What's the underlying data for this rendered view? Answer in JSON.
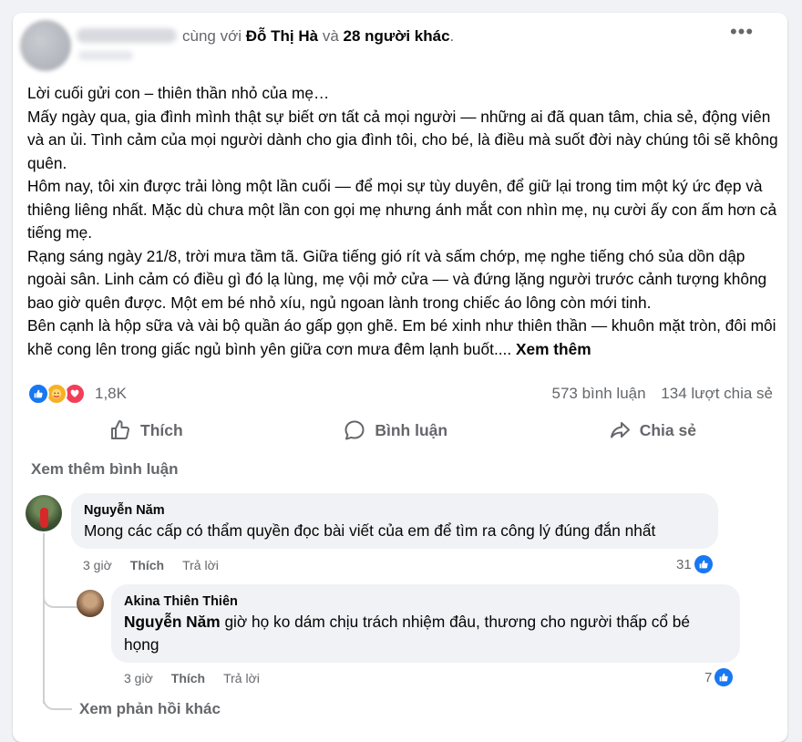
{
  "header": {
    "with_prefix": "cùng với",
    "tagged_person": "Đỗ Thị Hà",
    "and_word": "và",
    "others": "28 người khác",
    "period": ".",
    "more_label": "•••"
  },
  "post": {
    "paragraphs": [
      "Lời cuối gửi con – thiên thần nhỏ của mẹ…",
      "Mấy ngày qua, gia đình mình thật sự biết ơn tất cả mọi người — những ai đã quan tâm, chia sẻ, động viên và an ủi. Tình cảm của mọi người dành cho gia đình tôi, cho bé, là điều mà suốt đời này chúng tôi sẽ không quên.",
      "Hôm nay, tôi xin được trải lòng một lần cuối — để mọi sự tùy duyên, để giữ lại trong tim một ký ức đẹp và thiêng liêng nhất. Mặc dù chưa một lần con gọi mẹ nhưng ánh mắt con nhìn mẹ, nụ cười ấy con ấm hơn cả tiếng mẹ.",
      "Rạng sáng ngày 21/8, trời mưa tầm tã. Giữa tiếng gió rít và sấm chớp, mẹ nghe tiếng chó sủa dồn dập ngoài sân. Linh cảm có điều gì đó lạ lùng, mẹ vội mở cửa — và đứng lặng người trước cảnh tượng không bao giờ quên được. Một em bé nhỏ xíu, ngủ ngoan lành trong chiếc áo lông còn mới tinh.",
      "Bên cạnh là hộp sữa và vài bộ quần áo gấp gọn ghẽ. Em bé xinh như thiên thần — khuôn mặt tròn, đôi môi khẽ cong lên trong giấc ngủ bình yên giữa cơn mưa đêm lạnh buốt...."
    ],
    "see_more": "Xem thêm"
  },
  "reactions": {
    "icons": [
      "like-icon",
      "care-icon",
      "love-icon"
    ],
    "count": "1,8K",
    "comments": "573 bình luận",
    "shares": "134 lượt chia sẻ"
  },
  "actions": {
    "like": "Thích",
    "comment": "Bình luận",
    "share": "Chia sẻ"
  },
  "view_more_comments": "Xem thêm bình luận",
  "comments": [
    {
      "author": "Nguyễn Năm",
      "text": "Mong các cấp có thẩm quyền đọc bài viết của em để tìm ra công lý đúng đắn nhất",
      "time": "3 giờ",
      "like_label": "Thích",
      "reply_label": "Trả lời",
      "likes": "31"
    }
  ],
  "reply": {
    "author": "Akina Thiên Thiên",
    "mention": "Nguyễn Năm",
    "text": " giờ họ ko dám chịu trách nhiệm đâu, thương cho người thấp cổ bé họng",
    "time": "3 giờ",
    "like_label": "Thích",
    "reply_label": "Trả lời",
    "likes": "7"
  },
  "more_replies": "Xem phản hồi khác",
  "colors": {
    "background": "#f0f2f5",
    "card": "#ffffff",
    "secondary_text": "#65676b",
    "like_blue": "#1877f2",
    "love_red": "#f33e58",
    "care_yellow": "#f7b125"
  }
}
